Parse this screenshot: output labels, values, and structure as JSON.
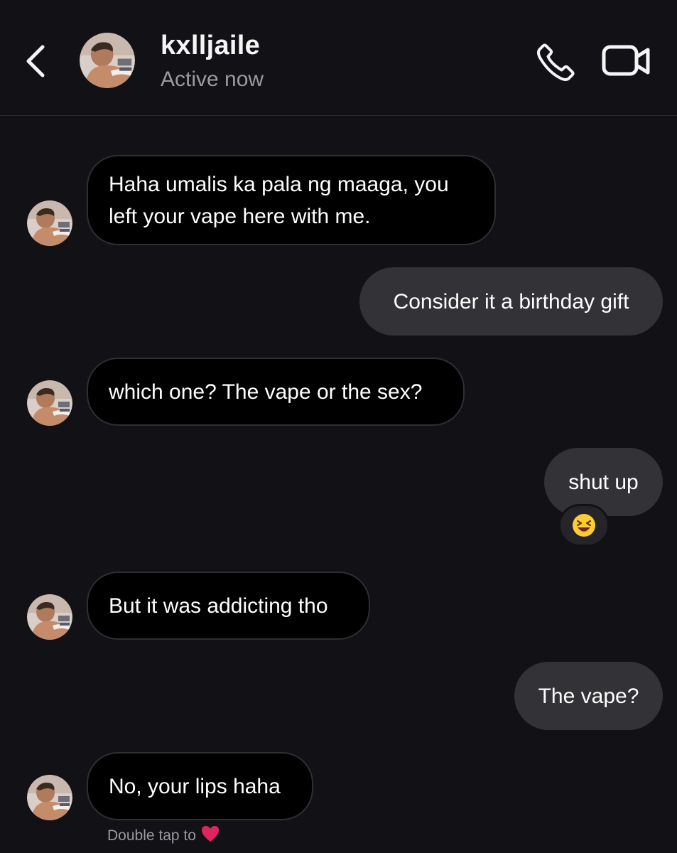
{
  "header": {
    "username": "kxlljaile",
    "status": "Active now",
    "icons": {
      "back": "chevron-left-icon",
      "call": "phone-icon",
      "video": "video-camera-icon"
    }
  },
  "messages": [
    {
      "sender": "kxlljaile",
      "direction": "incoming",
      "lines": [
        "Haha umalis ka pala ng maaga, you",
        "left your vape here with me."
      ]
    },
    {
      "sender": "me",
      "direction": "outgoing",
      "text": "Consider it a birthday gift"
    },
    {
      "sender": "kxlljaile",
      "direction": "incoming",
      "text": "which one? The vape or the sex?"
    },
    {
      "sender": "me",
      "direction": "outgoing",
      "text": "shut up",
      "reaction": "😆"
    },
    {
      "sender": "kxlljaile",
      "direction": "incoming",
      "text": "But it was addicting tho"
    },
    {
      "sender": "me",
      "direction": "outgoing",
      "text": "The vape?"
    },
    {
      "sender": "kxlljaile",
      "direction": "incoming",
      "text": "No, your lips haha"
    }
  ],
  "hint": {
    "text": "Double tap to",
    "icon": "heart-icon"
  },
  "colors": {
    "background": "#111116",
    "incoming_bubble": "#000000",
    "outgoing_bubble": "#333337",
    "heart": "#e0245e"
  }
}
